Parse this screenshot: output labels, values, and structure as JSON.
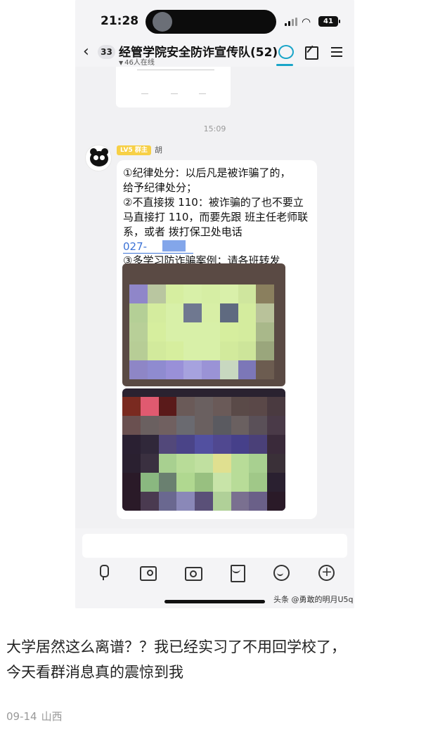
{
  "status_bar": {
    "time": "21:28",
    "battery": "41"
  },
  "chat_header": {
    "unread_count": "33",
    "group_name": "经管学院安全防诈宣传队(52)",
    "online": "46人在线"
  },
  "timestamp": "15:09",
  "message": {
    "badge": "LV5 群主",
    "sender": "胡",
    "lines": [
      "①纪律处分：以后凡是被诈骗了的，",
      "给予纪律处分；",
      "②不直接拨 110：被诈骗的了也不要立",
      "马直接打 110，而要先跟 班主任老师联",
      "系，或者 拨打保卫处电话"
    ],
    "phone_prefix": "027-",
    "last_line": "③多学习防诈骗案例；请各班转发"
  },
  "watermark": "头条 @勇敢的明月U5q",
  "post": {
    "lines": [
      "大学居然这么离谱？？我已经实习了不用回学校了，",
      "今天看群消息真的震惊到我"
    ],
    "date": "09-14",
    "location": "山西"
  },
  "colors": {
    "accent": "#1aa5c8",
    "link": "#3d73d6",
    "badge": "#f7d046",
    "chat_background": "#f1f1f3"
  },
  "icons": [
    "back-icon",
    "chat-icon",
    "edit-icon",
    "menu-icon",
    "mic-icon",
    "image-icon",
    "camera-icon",
    "red-packet-icon",
    "emoji-icon",
    "plus-icon"
  ]
}
